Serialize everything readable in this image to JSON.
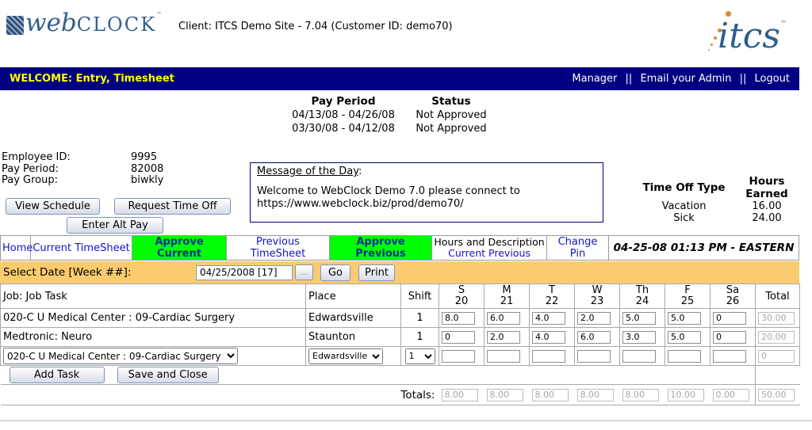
{
  "colors": {
    "navy_bar": "#000080",
    "welcome_yellow": "#FFFF00",
    "tab_green": "#00FF00",
    "date_bar_orange": "#FBCB70",
    "link_blue": "#1414CC",
    "logo_blue": "#2B5F8E",
    "logo_dot_orange": "#E0872E"
  },
  "header": {
    "logo_web": "web",
    "logo_clock": "CLOCK",
    "logo_tm": "™",
    "client_line": "Client: ITCS Demo Site - 7.04 (Customer ID: demo70)",
    "itcs_text": "itcs",
    "itcs_tm": "™"
  },
  "welcome_bar": {
    "welcome": "WELCOME: Entry, Timesheet",
    "links": [
      "Manager",
      "Email your Admin",
      "Logout"
    ],
    "separator": "||"
  },
  "pay_periods": {
    "headers": [
      "Pay Period",
      "Status"
    ],
    "rows": [
      {
        "period": "04/13/08 - 04/26/08",
        "status": "Not Approved"
      },
      {
        "period": "03/30/08 - 04/12/08",
        "status": "Not Approved"
      }
    ]
  },
  "employee": {
    "rows": [
      {
        "label": "Employee ID:",
        "value": "9995"
      },
      {
        "label": "Pay Period:",
        "value": "82008"
      },
      {
        "label": "Pay Group:",
        "value": "biwkly"
      }
    ]
  },
  "action_buttons": {
    "view_schedule": "View Schedule",
    "request_time_off": "Request Time Off",
    "enter_alt_pay": "Enter Alt Pay"
  },
  "motd": {
    "title": "Message of the Day",
    "colon": ":",
    "body": "Welcome to WebClock Demo 7.0 please connect to https://www.webclock.biz/prod/demo70/"
  },
  "time_off": {
    "headers": [
      "Time Off Type",
      "Hours Earned"
    ],
    "rows": [
      {
        "type": "Vacation",
        "hours": "16.00"
      },
      {
        "type": "Sick",
        "hours": "24.00"
      }
    ]
  },
  "nav": {
    "home": "Home",
    "current_timesheet": "Current TimeSheet",
    "approve_current": "Approve Current",
    "previous_timesheet": "Previous TimeSheet",
    "approve_previous": "Approve Previous",
    "hours_description": "Hours and Description",
    "hours_desc_links": [
      "Current",
      "Previous"
    ],
    "change_pin": "Change Pin",
    "datetime": "04-25-08 01:13 PM - EASTERN"
  },
  "date_bar": {
    "label": "Select Date [Week ##]:",
    "value": "04/25/2008 [17]",
    "ellipsis": "...",
    "go": "Go",
    "print": "Print"
  },
  "timesheet": {
    "col_headers": {
      "job": "Job: Job Task",
      "place": "Place",
      "shift": "Shift",
      "total": "Total"
    },
    "days": [
      {
        "day": "S",
        "date": "20"
      },
      {
        "day": "M",
        "date": "21"
      },
      {
        "day": "T",
        "date": "22"
      },
      {
        "day": "W",
        "date": "23"
      },
      {
        "day": "Th",
        "date": "24"
      },
      {
        "day": "F",
        "date": "25"
      },
      {
        "day": "Sa",
        "date": "26"
      }
    ],
    "rows": [
      {
        "job": "020-C U Medical Center : 09-Cardiac Surgery",
        "place": "Edwardsville",
        "shift": "1",
        "hours": [
          "8.0",
          "6.0",
          "4.0",
          "2.0",
          "5.0",
          "5.0",
          "0"
        ],
        "total": "30.00"
      },
      {
        "job": "Medtronic: Neuro",
        "place": "Staunton",
        "shift": "1",
        "hours": [
          "0",
          "2.0",
          "4.0",
          "6.0",
          "3.0",
          "5.0",
          "0"
        ],
        "total": "20.00"
      }
    ],
    "new_row": {
      "job_select": "020-C U Medical Center : 09-Cardiac Surgery",
      "place_select": "Edwardsville",
      "shift_select": "1",
      "total": "0"
    },
    "buttons": {
      "add_task": "Add Task",
      "save_and_close": "Save and Close"
    },
    "totals_label": "Totals:",
    "totals": [
      "8.00",
      "8.00",
      "8.00",
      "8.00",
      "8.00",
      "10.00",
      "0.00",
      "50.00"
    ]
  }
}
